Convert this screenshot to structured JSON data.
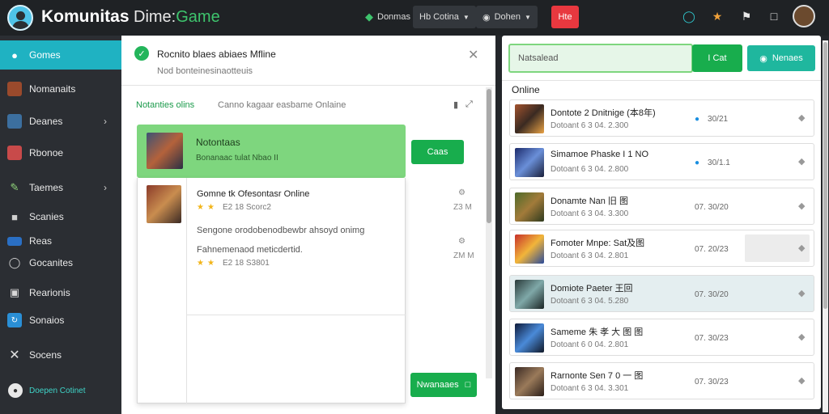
{
  "header": {
    "brand": "Komunitas",
    "brand_sub_a": "Dime:",
    "brand_sub_b": "Game",
    "btn1": "Donmas",
    "btn2": "Hb Cotina",
    "btn3": "Dohen",
    "btn4": "Hte"
  },
  "sidebar": {
    "items": [
      {
        "label": "Gomes",
        "icon": "game-controller-icon"
      },
      {
        "label": "Nomanaits",
        "icon": "avatar-icon"
      },
      {
        "label": "Deanes",
        "icon": "image-icon"
      },
      {
        "label": "Rbonoe",
        "icon": "console-icon"
      },
      {
        "label": "Taemes",
        "icon": "wrench-icon"
      },
      {
        "label": "Scanies",
        "icon": "gamepad-icon"
      },
      {
        "label": "Reas",
        "icon": "card-icon"
      },
      {
        "label": "Gocanites",
        "icon": "circle-icon"
      },
      {
        "label": "Rearionis",
        "icon": "headset-icon"
      },
      {
        "label": "Sonaios",
        "icon": "share-icon"
      },
      {
        "label": "Socens",
        "icon": "close-icon"
      }
    ],
    "bottom_label": "Doepen Cotinet"
  },
  "notification": {
    "title": "Rocnito blaes abiaes Mfline",
    "subtitle": "Nod bonteinesinaotteuis"
  },
  "section": {
    "tab_active": "Notanties olins",
    "tab_other": "Canno kagaar easbame Onlaine"
  },
  "highlight_card": {
    "name": "Notontaas",
    "sub": "Bonanaac tulat Nbao II",
    "button": "Caas"
  },
  "detail": {
    "title": "Gomne tk Ofesontasr Online",
    "rating1": "E2 18 Scorc2",
    "desc1": "Sengone orodobenodbewbr ahsoyd onimg",
    "desc2": "Fahnemenaod meticdertid.",
    "rating2": "E2 18 S3801",
    "meta1": "Z3 M",
    "meta2": "ZM M"
  },
  "main_bottom_button": "Nwanaaes",
  "right": {
    "search_placeholder": "Natsalead",
    "btn_green": "I Cat",
    "btn_teal": "Nenaes",
    "online_label": "Online",
    "rows": [
      {
        "name": "Dontote 2 Dnitnige (本8年)",
        "sub": "Dotoant 6 3 04. 2.300",
        "date": "30/21",
        "dot": true
      },
      {
        "name": "Simamoe Phaske I 1 NO",
        "sub": "Dotoant 6 3 04. 2.800",
        "date": "30/1.1",
        "dot": true
      },
      {
        "name": "Donamte Nan 旧 图",
        "sub": "Dotoant 6 3 04. 3.300",
        "date": "07. 30/20",
        "dot": false
      },
      {
        "name": "Fomoter Mnpe: Sat及图",
        "sub": "Dotoant 6 3 04. 2.801",
        "date": "07. 20/23",
        "dot": false
      },
      {
        "name": "Domiote Paeter 王回",
        "sub": "Dotoant 6 3 04. 5.280",
        "date": "07. 30/20",
        "dot": false
      },
      {
        "name": "Sameme 朱 孝 大 图 图",
        "sub": "Dotoant 6 0 04. 2.801",
        "date": "07. 30/23",
        "dot": false
      },
      {
        "name": "Rarnonte Sen 7 0 一 图",
        "sub": "Dotoant 6 3 04. 3.301",
        "date": "07. 30/23",
        "dot": false
      }
    ]
  },
  "colors": {
    "accent_teal": "#1fb2c2",
    "green": "#18ad4d",
    "highlight": "#7ed67e",
    "red": "#e8383f"
  }
}
